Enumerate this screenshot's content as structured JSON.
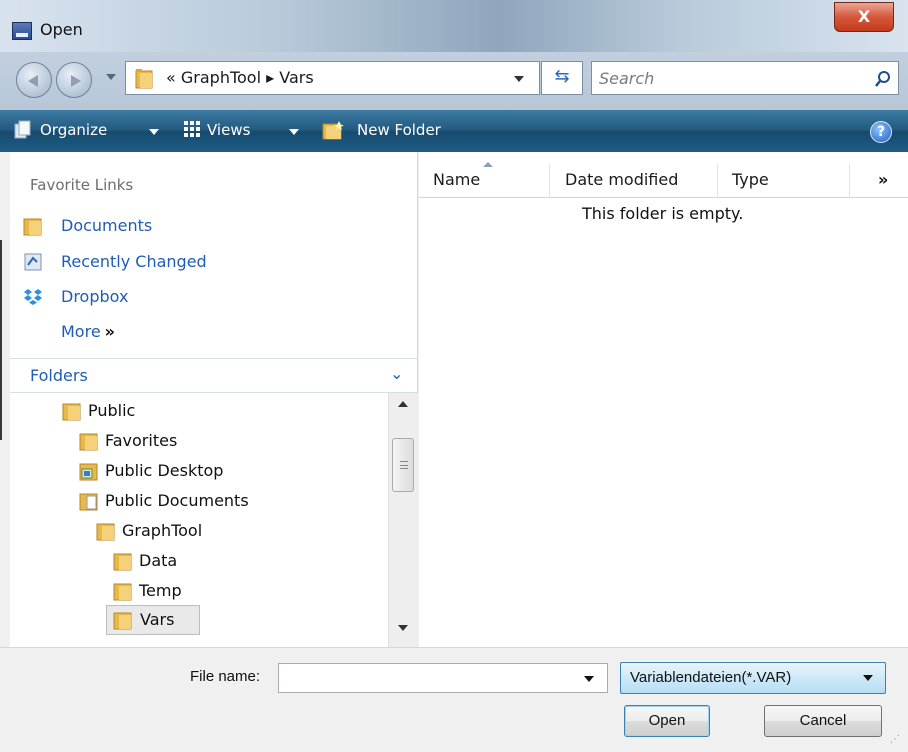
{
  "window": {
    "title": "Open",
    "close_label": "X"
  },
  "address": {
    "path": "« GraphTool ▸ Vars"
  },
  "search": {
    "placeholder": "Search"
  },
  "toolbar": {
    "organize_label": "Organize",
    "views_label": "Views",
    "new_folder_label": "New Folder",
    "help_label": "?"
  },
  "favorites": {
    "title": "Favorite Links",
    "items": [
      {
        "label": "Documents",
        "icon": "folder-icon"
      },
      {
        "label": "Recently Changed",
        "icon": "recent-icon"
      },
      {
        "label": "Dropbox",
        "icon": "dropbox-icon"
      }
    ],
    "more_label": "More",
    "more_chevron": "»"
  },
  "folders": {
    "title": "Folders",
    "chevron": "⌄",
    "tree": [
      {
        "label": "Public",
        "icon": "folder-icon",
        "selected": false
      },
      {
        "label": "Favorites",
        "icon": "folder-icon",
        "selected": false
      },
      {
        "label": "Public Desktop",
        "icon": "desktop-icon",
        "selected": false
      },
      {
        "label": "Public Documents",
        "icon": "documents-folder-icon",
        "selected": false
      },
      {
        "label": "GraphTool",
        "icon": "folder-icon",
        "selected": false
      },
      {
        "label": "Data",
        "icon": "folder-icon",
        "selected": false
      },
      {
        "label": "Temp",
        "icon": "folder-icon",
        "selected": false
      },
      {
        "label": "Vars",
        "icon": "folder-icon",
        "selected": true
      }
    ]
  },
  "file_list": {
    "columns": [
      "Name",
      "Date modified",
      "Type"
    ],
    "more_columns": "»",
    "empty_message": "This folder is empty."
  },
  "bottom": {
    "file_name_label": "File name:",
    "file_name_value": "",
    "file_type_value": "Variablendateien(*.VAR)",
    "open_label": "Open",
    "cancel_label": "Cancel"
  },
  "colors": {
    "toolbar": "#22597f",
    "link": "#1f5cb8",
    "close": "#d6573c",
    "folder": "#e8b94a"
  }
}
